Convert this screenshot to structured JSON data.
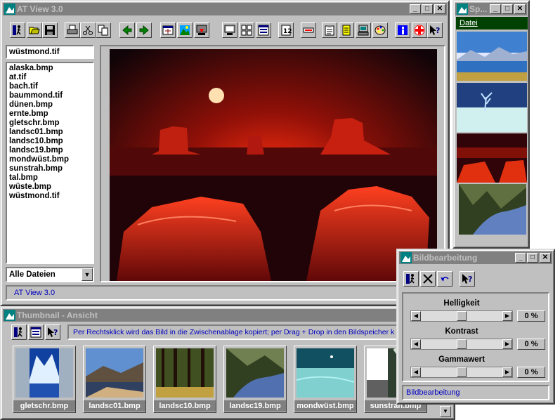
{
  "main_window": {
    "title": "AT View 3.0",
    "status": "AT View 3.0"
  },
  "file_panel": {
    "current_file": "wüstmond.tif",
    "files": [
      "alaska.bmp",
      "at.tif",
      "bach.tif",
      "baummond.tif",
      "dünen.bmp",
      "ernte.bmp",
      "gletschr.bmp",
      "landsc01.bmp",
      "landsc10.bmp",
      "landsc19.bmp",
      "mondwüst.bmp",
      "sunstrah.bmp",
      "tal.bmp",
      "wüste.bmp",
      "wüstmond.tif"
    ],
    "filter": "Alle Dateien"
  },
  "toolbar": {
    "icons": [
      "exit-icon",
      "open-icon",
      "save-icon",
      "print-icon",
      "cut-icon",
      "copy-icon",
      "back-icon",
      "forward-icon",
      "fit-icon",
      "image-icon",
      "download-icon",
      "monitor-icon",
      "grid-icon",
      "list-icon",
      "dice-icon",
      "minus-icon",
      "clipboard-icon",
      "note-icon",
      "scanner-icon",
      "palette-icon",
      "info-icon",
      "plus-icon",
      "help-icon"
    ]
  },
  "speicher_window": {
    "title": "Sp...",
    "menu": "Datei"
  },
  "thumbnail_window": {
    "title": "Thumbnail - Ansicht",
    "hint": "Per Rechtsklick wird das Bild in die Zwischenablage kopiert; per Drag + Drop in den Bildspeicher k",
    "thumbnails": [
      "gletschr.bmp",
      "landsc01.bmp",
      "landsc10.bmp",
      "landsc19.bmp",
      "mondwüst.bmp",
      "sunstrah.bmp"
    ]
  },
  "edit_window": {
    "title": "Bildbearbeitung",
    "status": "Bildbearbeitung",
    "sliders": [
      {
        "label": "Helligkeit",
        "value": "0 %",
        "level": 0.5
      },
      {
        "label": "Kontrast",
        "value": "0 %",
        "level": 0.5
      },
      {
        "label": "Gammawert",
        "value": "0 %",
        "level": 0.5
      }
    ]
  },
  "colors": {
    "title_inactive": "#808080",
    "desktop": "#c0c0c0",
    "status_text": "#0000c0"
  }
}
